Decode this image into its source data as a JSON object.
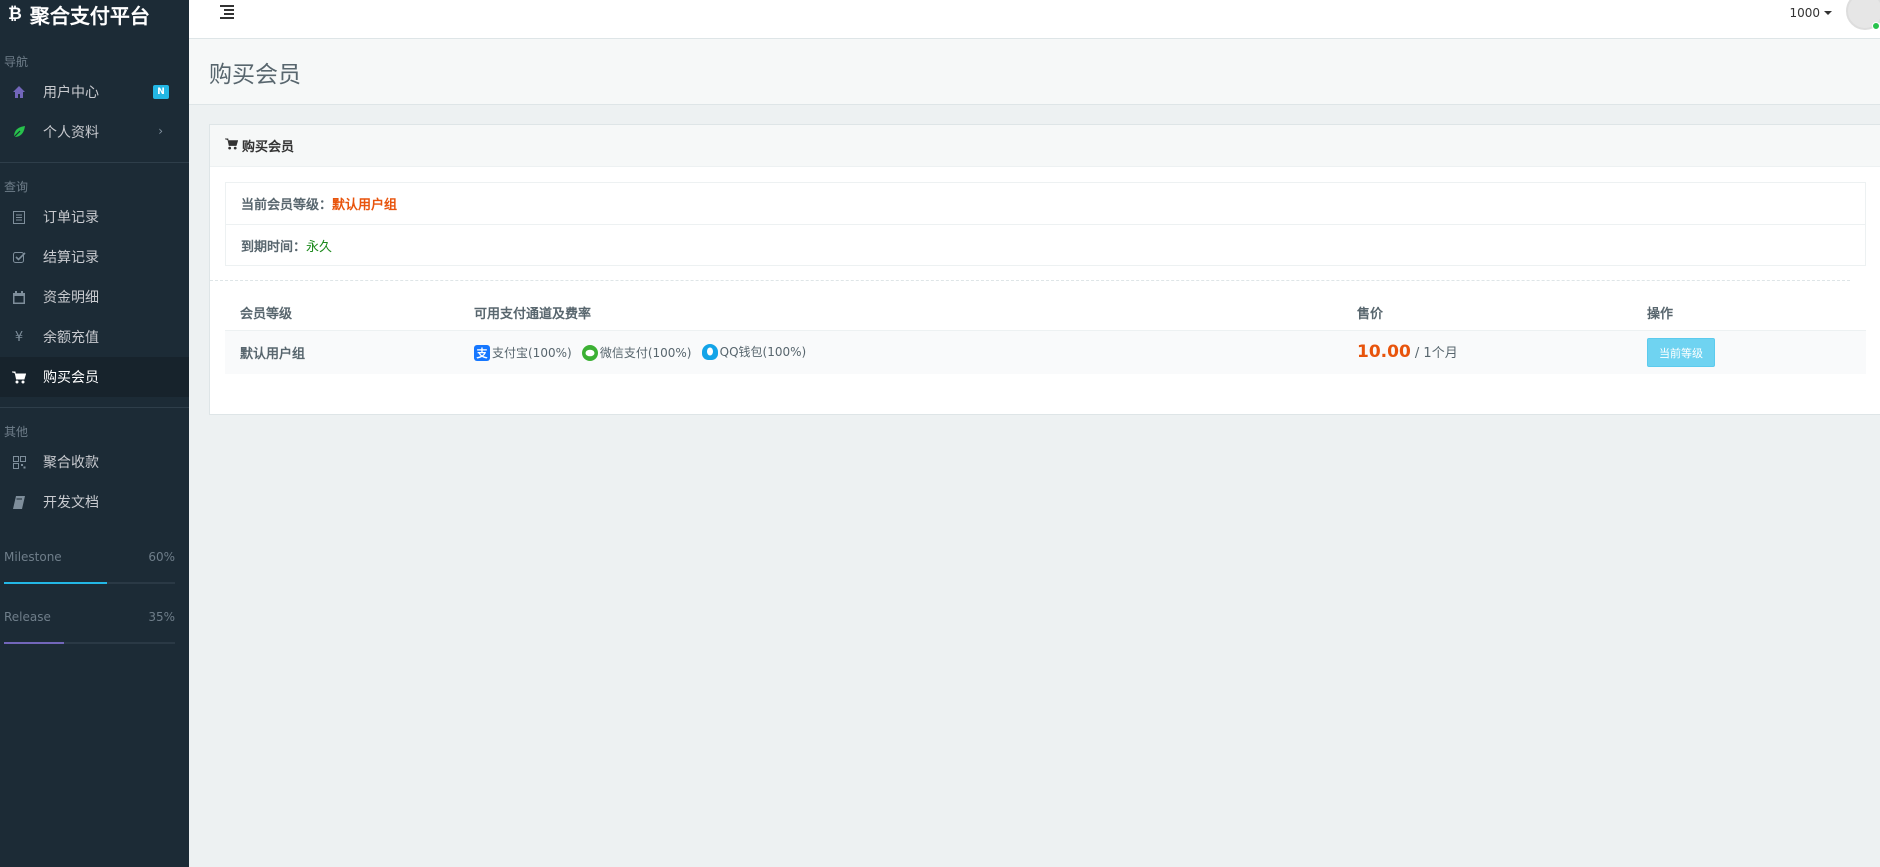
{
  "brand": {
    "logo": "₿",
    "name": "聚合支付平台"
  },
  "sidebar": {
    "section_nav": "导航",
    "section_query": "查询",
    "section_other": "其他",
    "items": [
      {
        "label": "用户中心",
        "icon": "home-icon",
        "badge": "N"
      },
      {
        "label": "个人资料",
        "icon": "leaf-icon",
        "chevron": "›"
      },
      {
        "label": "订单记录",
        "icon": "list-icon"
      },
      {
        "label": "结算记录",
        "icon": "check-square-icon"
      },
      {
        "label": "资金明细",
        "icon": "calendar-icon"
      },
      {
        "label": "余额充值",
        "icon": "yen-icon"
      },
      {
        "label": "购买会员",
        "icon": "cart-icon"
      },
      {
        "label": "聚合收款",
        "icon": "qrcode-icon"
      },
      {
        "label": "开发文档",
        "icon": "book-icon"
      }
    ],
    "progress": [
      {
        "label": "Milestone",
        "percent": "60%",
        "value": 60,
        "color": "#23b7e5"
      },
      {
        "label": "Release",
        "percent": "35%",
        "value": 35,
        "color": "#7266ba"
      }
    ]
  },
  "header": {
    "user_id": "1000"
  },
  "page": {
    "title": "购买会员"
  },
  "panel": {
    "heading": "购买会员",
    "current_level_label": "当前会员等级：",
    "current_level_value": "默认用户组",
    "expire_label": "到期时间：",
    "expire_value": "永久"
  },
  "table": {
    "headers": [
      "会员等级",
      "可用支付通道及费率",
      "售价",
      "操作"
    ],
    "rows": [
      {
        "level": "默认用户组",
        "channels": [
          {
            "name": "支付宝(100%)",
            "icon": "alipay-icon"
          },
          {
            "name": "微信支付(100%)",
            "icon": "wechat-icon"
          },
          {
            "name": "QQ钱包(100%)",
            "icon": "qq-icon"
          }
        ],
        "price": "10.00",
        "period": " / 1个月",
        "action": "当前等级"
      }
    ]
  },
  "colors": {
    "sidebar_bg": "#1c2b36",
    "accent": "#23b7e5",
    "price": "#e8540c",
    "green": "#1d8a1d"
  }
}
